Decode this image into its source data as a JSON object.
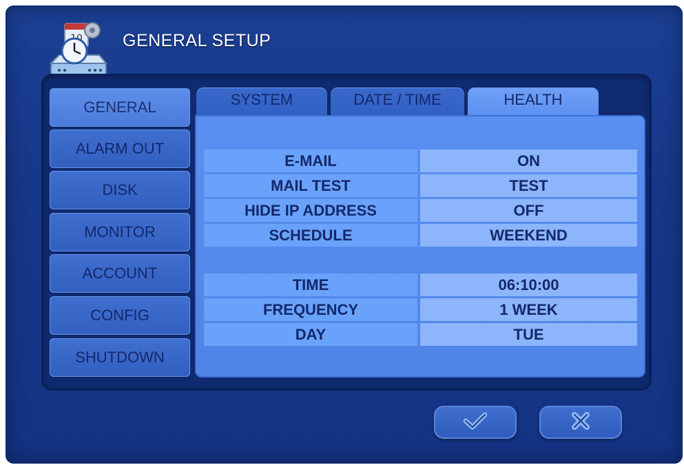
{
  "header": {
    "title": "GENERAL SETUP",
    "icon": "general-setup-icon"
  },
  "sidebar": {
    "items": [
      {
        "label": "GENERAL",
        "active": true
      },
      {
        "label": "ALARM OUT"
      },
      {
        "label": "DISK"
      },
      {
        "label": "MONITOR"
      },
      {
        "label": "ACCOUNT"
      },
      {
        "label": "CONFIG"
      },
      {
        "label": "SHUTDOWN"
      }
    ]
  },
  "tabs": [
    {
      "label": "SYSTEM"
    },
    {
      "label": "DATE / TIME"
    },
    {
      "label": "HEALTH",
      "active": true
    }
  ],
  "settings": {
    "group1": [
      {
        "label": "E-MAIL",
        "value": "ON"
      },
      {
        "label": "MAIL TEST",
        "value": "TEST"
      },
      {
        "label": "HIDE IP ADDRESS",
        "value": "OFF"
      },
      {
        "label": "SCHEDULE",
        "value": "WEEKEND"
      }
    ],
    "group2": [
      {
        "label": "TIME",
        "value": "06:10:00"
      },
      {
        "label": "FREQUENCY",
        "value": "1 WEEK"
      },
      {
        "label": "DAY",
        "value": "TUE"
      }
    ]
  },
  "footer": {
    "ok_icon": "checkmark-icon",
    "cancel_icon": "close-icon"
  },
  "colors": {
    "background": "#163888",
    "panel": "#5a8ff0",
    "label_cell": "#6aa2fb",
    "value_cell": "#8cb5fb",
    "text": "#13286a"
  }
}
